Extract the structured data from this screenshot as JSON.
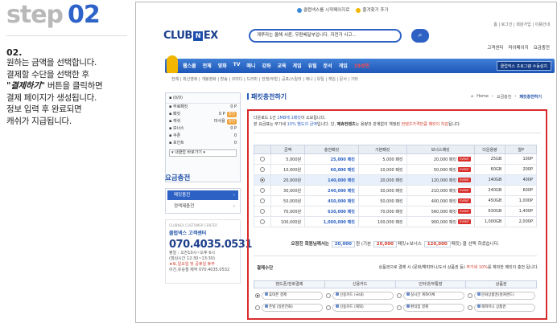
{
  "step": {
    "word": "step",
    "number": "02"
  },
  "instruction": {
    "num": "02.",
    "line1": "원하는 금액을 선택합니다.",
    "line2": "결제할 수단을 선택한 후",
    "highlight": "\"결제하기\"",
    "line3_rest": " 버튼을 클릭하면",
    "line4": "결제 페이지가 생성됩니다.",
    "line5": "정보 입력 후 완료되면",
    "line6": "캐쉬가 지급됩니다."
  },
  "site": {
    "toplink_home": "클럽넥스를 시작페이지로",
    "toplink_fav": "즐겨찾기 추가",
    "account_links": "홈 | 로그인 | 회원가입 | 이용안내",
    "logo_a": "CLUB",
    "logo_box": "N",
    "logo_b": "EX",
    "search_text": "계루라는 올해 서른, 우편배달부입니다. 자전거 사고...",
    "search_icon": "search-icon",
    "utility": [
      "고객센터",
      "마이페이지",
      "요금충전"
    ],
    "gnb_items": [
      "웹스쿨",
      "전체",
      "영화",
      "TV",
      "애니",
      "강좌",
      "교육",
      "게임",
      "유틸",
      "문서",
      "게임",
      "19성인"
    ],
    "gnb_promo": "클럽넥스 프로그램 수동설치",
    "subnav": "전체 | 최신영화 | 개봉영화 | 방송 | 코미디 | 드라마 | 전쟁/무협 | 공포/스릴러 | 애니 | 유틸 | 게임 | 문서 | 기타",
    "colors": {
      "brand": "#2d61c4",
      "alert": "#d92b2b",
      "gold": "#f2b600"
    }
  },
  "sidebar": {
    "header": "▪ (0/0)",
    "rows": [
      {
        "label": "▪ 무료패킷",
        "value": "0 P",
        "tag": ""
      },
      {
        "label": "▪ 패킷",
        "value": "0 P",
        "tag": "충전"
      },
      {
        "label": "▪ 캐쉬",
        "value": "미사용",
        "tag": "충전"
      },
      {
        "label": "▪ 보너스",
        "value": "0 P",
        "tag": ""
      },
      {
        "label": "▪ 쿠폰",
        "value": "0",
        "tag": ""
      },
      {
        "label": "▪ 포인트",
        "value": "0",
        "tag": ""
      }
    ],
    "quick_select": "▾ 내클럽 바로가기 ▾",
    "section_title": "요금충전",
    "menu": [
      {
        "label": "패킷충전",
        "on": true
      },
      {
        "label": "정액제충전",
        "on": false
      }
    ],
    "cs": {
      "small": "CLUBNEX CUSTOMER CENTER",
      "name": "클럽넥스 고객센터",
      "tel": "070.4035.0531",
      "hours1": "평일 : 오전10시~오후 6시",
      "hours2": "(점심시간 12:30~13:30)",
      "holiday": "★토,일요일 및 공휴일 휴무",
      "email": "이건,유승철 제작 070.4035.0532"
    }
  },
  "main": {
    "title": "패킷충전하기",
    "crumb": [
      "Home",
      "요금충전",
      "패킷충전하기"
    ],
    "notice_line1_a": "다운로드 1건 ",
    "notice_line1_b": "1MB에 1패킷",
    "notice_line1_c": "이 소모됩니다.",
    "notice_line2_a": "본 요금표는 부가세 ",
    "notice_line2_b": "10% 별도의 금액",
    "notice_line2_c": "입니다. 단, ",
    "notice_line2_d": "제휴컨텐츠",
    "notice_line2_e": "는 용량과 관계없이 책정된 ",
    "notice_line2_f": "컨텐츠가격만큼 패킷이 차감",
    "notice_line2_g": "됩니다.",
    "table_headers": [
      "",
      "금액",
      "충전패킷",
      "기본패킷",
      "보너스패킷",
      "다운용량",
      "알P"
    ],
    "rows": [
      {
        "price": "5,000원",
        "charge": "25,000 패킷",
        "base": "5,000 패킷",
        "bonus": "20,000 패킷",
        "cap": "25GB",
        "p": "100P",
        "sel": false
      },
      {
        "price": "10,000원",
        "charge": "60,000 패킷",
        "base": "10,000 패킷",
        "bonus": "50,000 패킷",
        "cap": "60GB",
        "p": "200P",
        "sel": false
      },
      {
        "price": "20,000원",
        "charge": "140,000 패킷",
        "base": "20,000 패킷",
        "bonus": "120,000 패킷",
        "cap": "140GB",
        "p": "400P",
        "sel": true
      },
      {
        "price": "30,000원",
        "charge": "240,000 패킷",
        "base": "30,000 패킷",
        "bonus": "210,000 패킷",
        "cap": "240GB",
        "p": "600P",
        "sel": false
      },
      {
        "price": "50,000원",
        "charge": "450,000 패킷",
        "base": "50,000 패킷",
        "bonus": "400,000 패킷",
        "cap": "450GB",
        "p": "1,000P",
        "sel": false
      },
      {
        "price": "70,000원",
        "charge": "630,000 패킷",
        "base": "70,000 패킷",
        "bonus": "560,000 패킷",
        "cap": "630GB",
        "p": "1,400P",
        "sel": false
      },
      {
        "price": "100,000원",
        "charge": "1,000,000 패킷",
        "base": "100,000 패킷",
        "bonus": "900,000 패킷",
        "cap": "1,000GB",
        "p": "2,000P",
        "sel": false
      }
    ],
    "event_tag": "EVENT",
    "summary": {
      "prefix": "오정진 회원님께서는",
      "amount": "20,000",
      "t1": "원 (기본",
      "base": "20,000",
      "t2": "패킷+보너스",
      "bonus": "120,000",
      "t3": "패킷) 을 선택 하셨습니다."
    },
    "pay": {
      "label": "결제수단",
      "note_a": "상품권으로 결제 시 (문화/해피머니/도서 상품권 등) ",
      "note_b": "부가세 10%",
      "note_c": "를 제외한 패킷이 충전 됩니다.",
      "heads": [
        "핸드폰/전화결제",
        "신용카드",
        "인터넷/무통장",
        "상품권"
      ],
      "cols": [
        [
          "휴대폰 결제",
          "폰빌 (일반전화)"
        ],
        [
          "신용카드 (국내)",
          "신용카드 (해외)"
        ],
        [
          "실시간 계좌이체",
          "편의점 결제"
        ],
        [
          "문화상품권(컬쳐랜드)",
          "해피머니 상품권"
        ]
      ]
    }
  }
}
